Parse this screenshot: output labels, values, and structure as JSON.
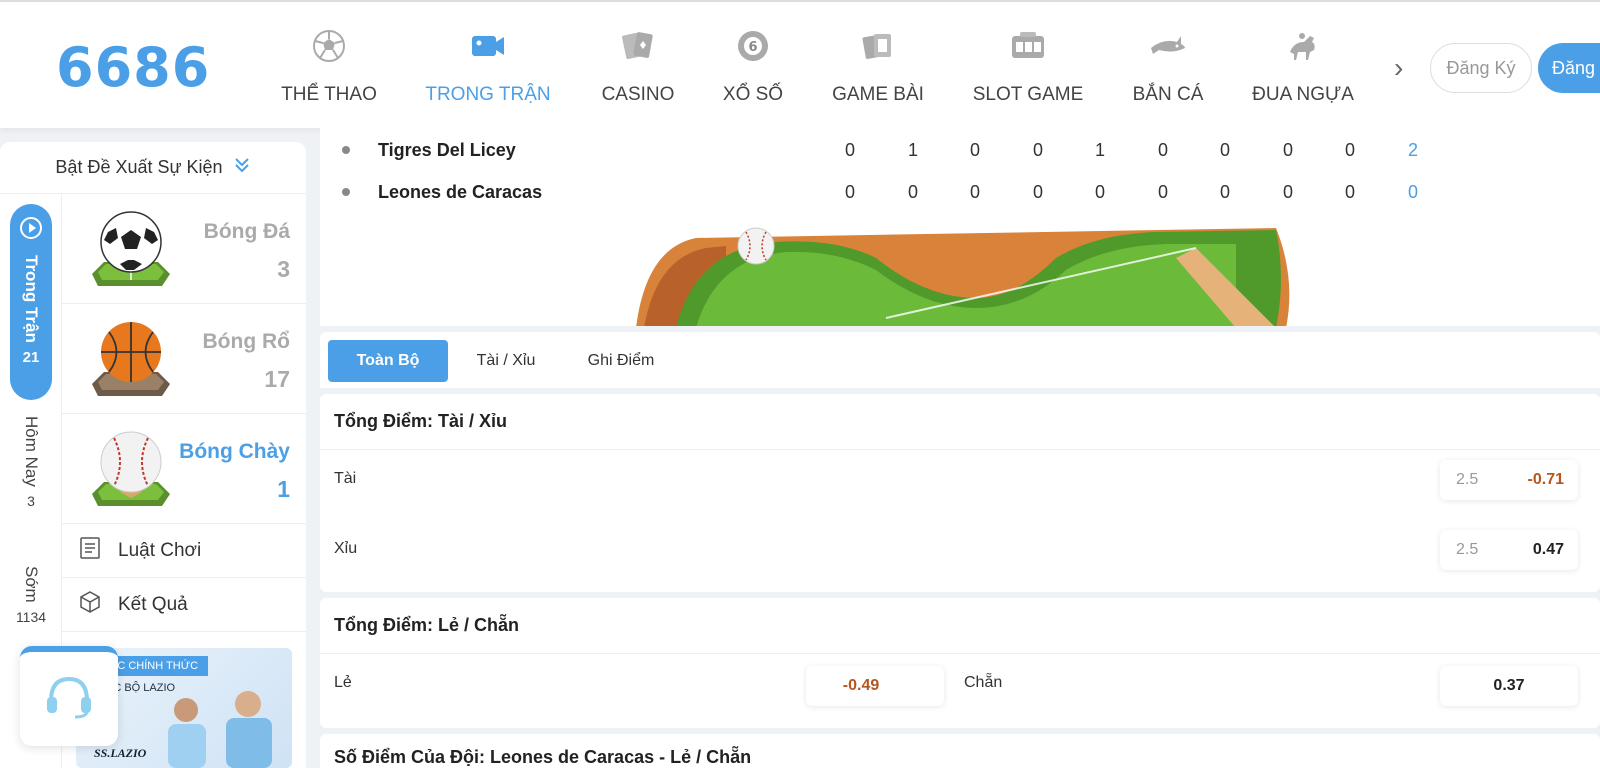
{
  "header": {
    "logo": "6686",
    "nav": [
      {
        "label": "THỂ THAO",
        "icon": "soccer-ball-icon"
      },
      {
        "label": "TRONG TRẬN",
        "icon": "video-camera-icon",
        "active": true
      },
      {
        "label": "CASINO",
        "icon": "playing-cards-icon"
      },
      {
        "label": "XỔ SỐ",
        "icon": "lottery-ball-icon"
      },
      {
        "label": "GAME BÀI",
        "icon": "card-game-icon"
      },
      {
        "label": "SLOT GAME",
        "icon": "slot-machine-icon"
      },
      {
        "label": "BẮN CÁ",
        "icon": "shark-icon"
      },
      {
        "label": "ĐUA NGỰA",
        "icon": "horse-racing-icon"
      }
    ],
    "register_label": "Đăng Ký",
    "login_label": "Đăng"
  },
  "sidebar": {
    "heading": "Bật Đề Xuất Sự Kiện",
    "tabs": {
      "live": {
        "label": "Trong Trận",
        "count": "21"
      },
      "today": {
        "label": "Hôm Nay",
        "count": "3"
      },
      "early": {
        "label": "Sớm",
        "count": "1134"
      }
    },
    "sports": [
      {
        "name": "Bóng Đá",
        "count": "3"
      },
      {
        "name": "Bóng Rổ",
        "count": "17"
      },
      {
        "name": "Bóng Chày",
        "count": "1",
        "active": true
      }
    ],
    "links": [
      {
        "label": "Luật Chơi",
        "icon": "rules-document-icon"
      },
      {
        "label": "Kết Quả",
        "icon": "results-box-icon"
      }
    ],
    "banner": {
      "tag": "ÁC CHÍNH THỨC",
      "subtitle": "ẠC BỘ LAZIO",
      "logo_text": "SS.LAZIO"
    }
  },
  "scoreboard": {
    "teams": [
      {
        "name": "Tigres Del Licey",
        "innings": [
          "0",
          "1",
          "0",
          "0",
          "1",
          "0",
          "0",
          "0",
          "0"
        ],
        "total": "2"
      },
      {
        "name": "Leones de Caracas",
        "innings": [
          "0",
          "0",
          "0",
          "0",
          "0",
          "0",
          "0",
          "0",
          "0"
        ],
        "total": "0"
      }
    ]
  },
  "market_tabs": [
    "Toàn Bộ",
    "Tài / Xỉu",
    "Ghi Điểm"
  ],
  "markets": {
    "total_ou": {
      "title": "Tổng Điểm: Tài / Xỉu",
      "rows": [
        {
          "label": "Tài",
          "line": "2.5",
          "price": "-0.71"
        },
        {
          "label": "Xỉu",
          "line": "2.5",
          "price": "0.47"
        }
      ]
    },
    "total_oe": {
      "title": "Tổng Điểm: Lẻ / Chẵn",
      "odd_label": "Lẻ",
      "odd_price": "-0.49",
      "even_label": "Chẵn",
      "even_price": "0.37"
    },
    "team_oe": {
      "title": "Số Điểm Của Đội: Leones de Caracas - Lẻ / Chẵn"
    }
  },
  "colors": {
    "accent": "#4a9fe6",
    "negative_price": "#b5561e"
  }
}
